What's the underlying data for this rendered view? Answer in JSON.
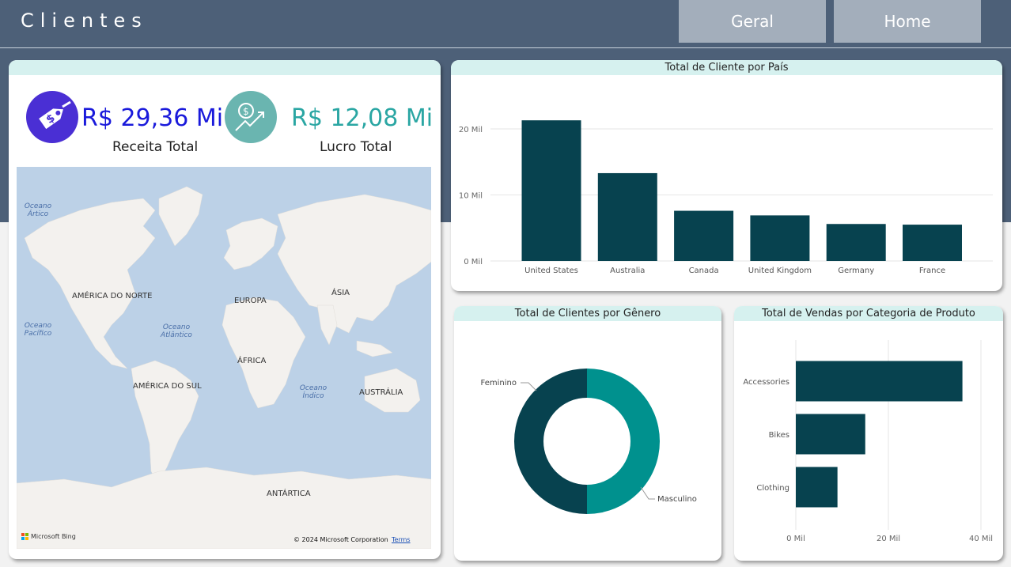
{
  "header": {
    "title": "Clientes",
    "nav": [
      {
        "label": "Geral"
      },
      {
        "label": "Home"
      }
    ]
  },
  "kpis": [
    {
      "value": "R$ 29,36 Mi",
      "label": "Receita Total",
      "icon": "price-tag-icon",
      "color": "#1a1adb"
    },
    {
      "value": "R$ 12,08 Mi",
      "label": "Lucro Total",
      "icon": "profit-growth-icon",
      "color": "#2aa6a3"
    }
  ],
  "map": {
    "labels": [
      "AMÉRICA DO NORTE",
      "EUROPA",
      "ÁSIA",
      "ÁFRICA",
      "AMÉRICA DO SUL",
      "AUSTRÁLIA",
      "ANTÁRTICA"
    ],
    "oceans": [
      "Oceano Ártico",
      "Oceano Pacífico",
      "Oceano Atlântico",
      "Oceano Índico"
    ],
    "attribution": "Microsoft Bing",
    "copyright": "© 2024 Microsoft Corporation",
    "terms": "Terms"
  },
  "colors": {
    "bar": "#07424f",
    "teal": "#00918e",
    "header": "#4d6078"
  },
  "chart_data": [
    {
      "type": "bar",
      "title": "Total de Cliente por País",
      "categories": [
        "United States",
        "Australia",
        "Canada",
        "United Kingdom",
        "Germany",
        "France"
      ],
      "values": [
        21300,
        13300,
        7600,
        6900,
        5600,
        5500
      ],
      "yticks": [
        "0 Mil",
        "10 Mil",
        "20 Mil"
      ],
      "ylim": [
        0,
        20000
      ]
    },
    {
      "type": "pie",
      "title": "Total de Clientes por Gênero",
      "categories": [
        "Feminino",
        "Masculino"
      ],
      "values": [
        50,
        50
      ]
    },
    {
      "type": "bar",
      "orientation": "horizontal",
      "title": "Total de Vendas por Categoria de Produto",
      "categories": [
        "Accessories",
        "Bikes",
        "Clothing"
      ],
      "values": [
        36000,
        15000,
        9000
      ],
      "xticks": [
        "0 Mil",
        "20 Mil",
        "40 Mil"
      ],
      "xlim": [
        0,
        40000
      ]
    }
  ]
}
